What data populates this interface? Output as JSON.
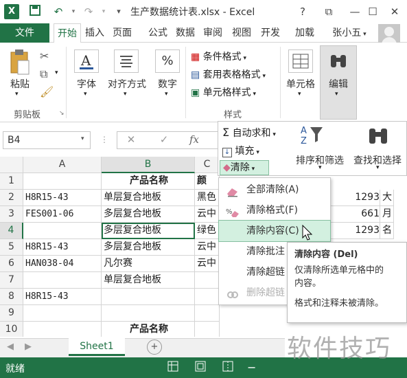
{
  "app": {
    "title": "生产数据统计表.xlsx - Excel",
    "logo_letter": "X",
    "window_controls": [
      "?",
      "⧉",
      "—",
      "☐",
      "✕"
    ]
  },
  "tabs": {
    "file": "文件",
    "items": [
      "开始",
      "插入",
      "页面",
      "公式",
      "数据",
      "审阅",
      "视图",
      "开发",
      "加载"
    ],
    "user": "张小五"
  },
  "ribbon": {
    "paste": "粘贴",
    "clipboard_group": "剪贴板",
    "font": "字体",
    "alignment": "对齐方式",
    "number": "数字",
    "styles": {
      "conditional": "条件格式",
      "table_format": "套用表格格式",
      "cell_styles": "单元格样式",
      "group_label": "样式"
    },
    "cells": "单元格",
    "editing": "编辑"
  },
  "formula_bar": {
    "name_box": "B4",
    "fx": "fx"
  },
  "edit_panel": {
    "autosum": "自动求和",
    "fill": "填充",
    "clear": "清除",
    "sort_filter": "排序和筛选",
    "find_select": "查找和选择"
  },
  "grid": {
    "columns": [
      "A",
      "B",
      "C"
    ],
    "rows": [
      {
        "n": "1",
        "a": "",
        "b": "产品名称",
        "c": "颜"
      },
      {
        "n": "2",
        "a": "H8R15-43",
        "b": "单层复合地板",
        "c": "黑色"
      },
      {
        "n": "3",
        "a": "FES001-06",
        "b": "多层复合地板",
        "c": "云中"
      },
      {
        "n": "4",
        "a": "",
        "b": "多层复合地板",
        "c": "绿色"
      },
      {
        "n": "5",
        "a": "H8R15-43",
        "b": "多层复合地板",
        "c": "云中"
      },
      {
        "n": "6",
        "a": "HAN038-04",
        "b": "凡尔赛",
        "c": "云中"
      },
      {
        "n": "7",
        "a": "",
        "b": "单层复合地板",
        "c": ""
      },
      {
        "n": "8",
        "a": "H8R15-43",
        "b": "",
        "c": ""
      },
      {
        "n": "9",
        "a": "",
        "b": "",
        "c": ""
      },
      {
        "n": "10",
        "a": "",
        "b": "产品名称",
        "c": ""
      }
    ],
    "right_values": [
      {
        "row": 2,
        "v": "1293",
        "e": "大"
      },
      {
        "row": 3,
        "v": "661",
        "e": "月"
      },
      {
        "row": 4,
        "v": "1293",
        "e": "名"
      }
    ]
  },
  "clear_menu": {
    "items": [
      {
        "label": "全部清除(A)",
        "state": "normal"
      },
      {
        "label": "清除格式(F)",
        "state": "normal"
      },
      {
        "label": "清除内容(C)",
        "state": "hover"
      },
      {
        "label": "清除批注",
        "state": "normal"
      },
      {
        "label": "清除超链",
        "state": "normal"
      },
      {
        "label": "删除超链",
        "state": "disabled"
      }
    ]
  },
  "tooltip": {
    "title": "清除内容 (Del)",
    "desc1": "仅清除所选单元格中的",
    "desc2": "内容。",
    "note": "格式和注释未被清除。"
  },
  "sheet": {
    "tab": "Sheet1",
    "add": "+"
  },
  "status": {
    "ready": "就绪"
  },
  "watermark": "软件技巧",
  "colors": {
    "accent": "#217346",
    "hover": "#d3f0e0"
  }
}
